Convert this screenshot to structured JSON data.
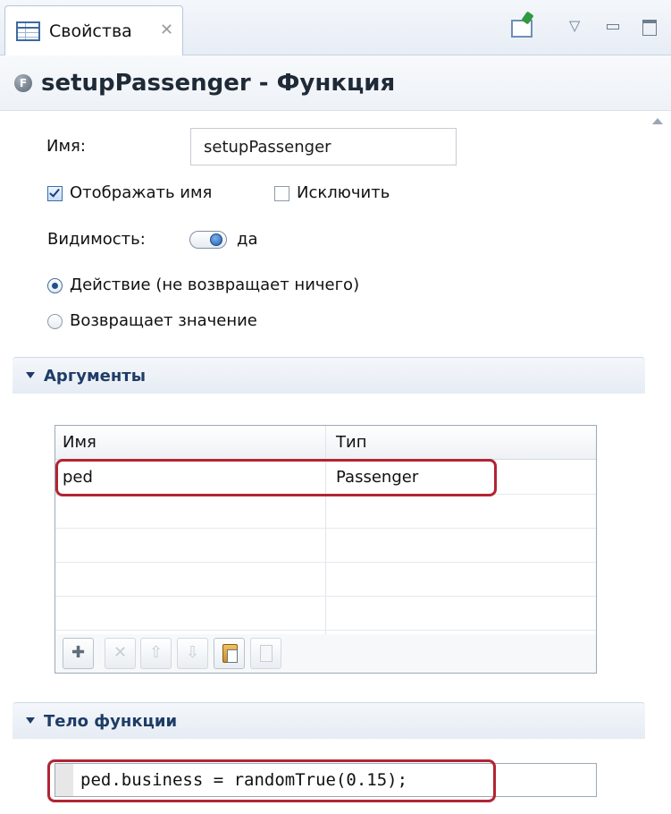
{
  "tab": {
    "label": "Свойства",
    "icon": "properties-view-icon",
    "close_icon": "close-tab-icon"
  },
  "view_tools": {
    "pin_icon": "pin-editor-icon",
    "menu_icon": "view-menu-icon",
    "minimize_icon": "minimize-icon",
    "maximize_icon": "maximize-icon"
  },
  "header": {
    "icon": "function-icon",
    "title": "setupPassenger - Функция"
  },
  "general": {
    "name_label": "Имя:",
    "name_value": "setupPassenger",
    "show_name_label": "Отображать имя",
    "show_name_checked": true,
    "exclude_label": "Исключить",
    "exclude_checked": false,
    "visibility_label": "Видимость:",
    "visibility_value": "да",
    "visibility_on": true,
    "return_options": [
      {
        "label": "Действие (не возвращает ничего)",
        "selected": true
      },
      {
        "label": "Возвращает значение",
        "selected": false
      }
    ]
  },
  "arguments": {
    "section_title": "Аргументы",
    "columns": [
      "Имя",
      "Тип"
    ],
    "rows": [
      {
        "name": "ped",
        "type": "Passenger"
      }
    ],
    "toolbar": [
      {
        "icon": "add-icon",
        "glyph": "✚",
        "enabled": true
      },
      {
        "icon": "delete-icon",
        "glyph": "✕",
        "enabled": false
      },
      {
        "icon": "move-up-icon",
        "glyph": "⇧",
        "enabled": false
      },
      {
        "icon": "move-down-icon",
        "glyph": "⇩",
        "enabled": false
      },
      {
        "icon": "paste-icon",
        "glyph": "",
        "enabled": true
      },
      {
        "icon": "copy-icon",
        "glyph": "",
        "enabled": false
      }
    ]
  },
  "body": {
    "section_title": "Тело функции",
    "code": "ped.business = randomTrue(0.15);"
  },
  "colors": {
    "highlight": "#b22433",
    "section_title": "#1e3c66",
    "accent": "#3e6da5"
  }
}
